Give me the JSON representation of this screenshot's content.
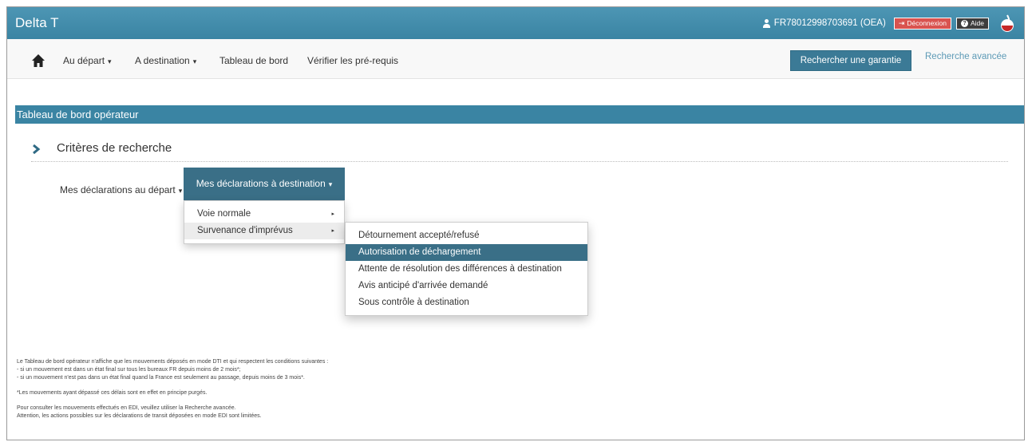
{
  "header": {
    "brand": "Delta T",
    "user": "FR78012998703691 (OEA)",
    "logout_label": "Déconnexion",
    "help_label": "Aide",
    "color": "#3a84a3"
  },
  "nav": {
    "items": [
      {
        "label": "Au départ",
        "dropdown": true
      },
      {
        "label": "A destination",
        "dropdown": true
      },
      {
        "label": "Tableau de bord",
        "dropdown": false
      },
      {
        "label": "Vérifier les pré-requis",
        "dropdown": false
      }
    ],
    "search_guarantee_label": "Rechercher une garantie",
    "advanced_search_label": "Recherche avancée",
    "caret": "▾"
  },
  "page": {
    "section_title": "Tableau de bord opérateur",
    "criteria_title": "Critères de recherche"
  },
  "tabs": {
    "depart_label": "Mes déclarations au départ",
    "destination_label": "Mes déclarations à destination",
    "caret": "▾"
  },
  "dropdown_main": {
    "items": [
      {
        "label": "Voie normale",
        "arrow": "▸"
      },
      {
        "label": "Survenance d'imprévus",
        "arrow": "▸"
      }
    ]
  },
  "dropdown_sub": {
    "items": [
      {
        "label": "Détournement accepté/refusé"
      },
      {
        "label": "Autorisation de déchargement",
        "active": true
      },
      {
        "label": "Attente de résolution des différences à destination"
      },
      {
        "label": "Avis anticipé d'arrivée demandé"
      },
      {
        "label": "Sous contrôle à destination"
      }
    ]
  },
  "notes": {
    "line1": "Le Tableau de bord opérateur n'affiche que les mouvements déposés en mode DTI et qui respectent les conditions suivantes :",
    "line2": "- si un mouvement est dans un état final sur tous les bureaux FR depuis moins de 2 mois*;",
    "line3": "- si un mouvement n'est pas dans un état final quand la France est seulement au passage, depuis moins de 3 mois*.",
    "line4": "*Les mouvements ayant dépassé ces délais sont en effet en principe purgés.",
    "line5": "Pour consulter les mouvements effectués en EDI, veuillez utiliser la Recherche avancée.",
    "line6": "Attention, les actions possibles sur les déclarations de transit déposées en mode EDI sont limitées."
  }
}
